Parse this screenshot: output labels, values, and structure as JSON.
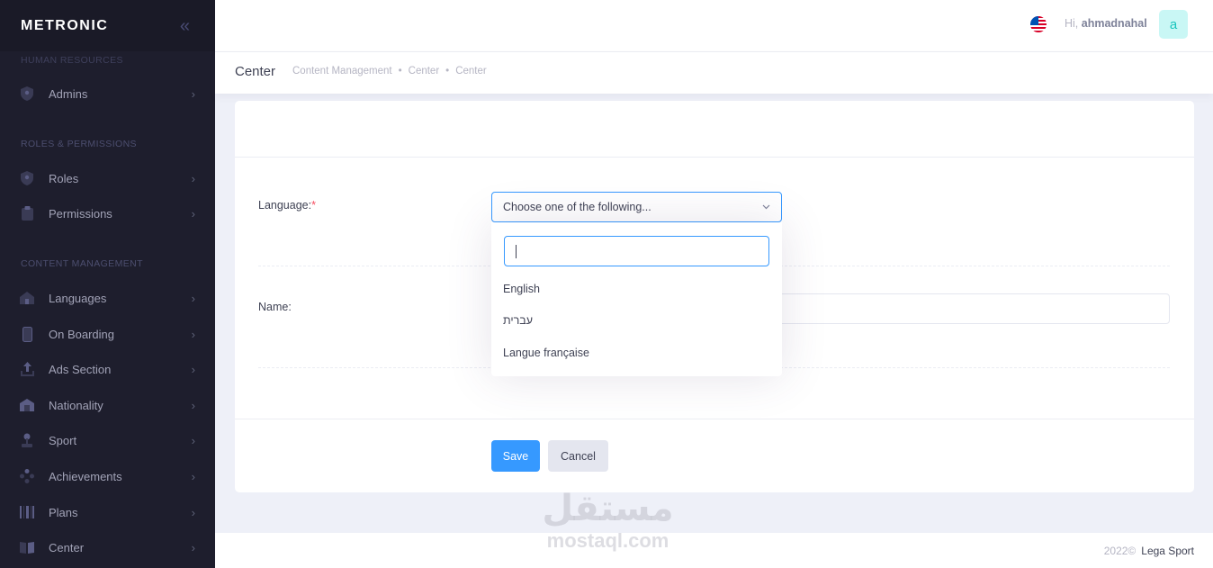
{
  "sidebar": {
    "brand": "METRONIC",
    "sections": {
      "human_resources": "HUMAN RESOURCES",
      "roles_permissions": "ROLES & PERMISSIONS",
      "content_management": "CONTENT MANAGEMENT"
    },
    "items": [
      {
        "label": "Admins",
        "icon": "shield-icon"
      },
      {
        "label": "Roles",
        "icon": "shield-icon"
      },
      {
        "label": "Permissions",
        "icon": "clipboard-icon"
      },
      {
        "label": "Languages",
        "icon": "home-icon"
      },
      {
        "label": "On Boarding",
        "icon": "phone-icon"
      },
      {
        "label": "Ads Section",
        "icon": "upload-icon"
      },
      {
        "label": "Nationality",
        "icon": "building-icon"
      },
      {
        "label": "Sport",
        "icon": "joystick-icon"
      },
      {
        "label": "Achievements",
        "icon": "gamepad-icon"
      },
      {
        "label": "Plans",
        "icon": "barcode-icon"
      },
      {
        "label": "Center",
        "icon": "book-icon"
      }
    ]
  },
  "header": {
    "greeting_prefix": "Hi,",
    "username": "ahmadnahal",
    "avatar_letter": "a",
    "flag": "us-flag-icon"
  },
  "subheader": {
    "title": "Center",
    "breadcrumb": [
      "Content Management",
      "Center",
      "Center"
    ]
  },
  "form": {
    "language_label": "Language:",
    "required_mark": "*",
    "select_placeholder": "Choose one of the following...",
    "search_value": "",
    "options": [
      "English",
      "עברית",
      "Langue française"
    ],
    "name_label": "Name:",
    "name_value": "",
    "save_label": "Save",
    "cancel_label": "Cancel"
  },
  "footer": {
    "year": "2022©",
    "company": "Lega Sport"
  },
  "watermark": {
    "arabic": "مستقل",
    "latin": "mostaql.com"
  },
  "colors": {
    "primary": "#3699ff",
    "sidebar_bg": "#1e1e2d",
    "brand_bg": "#1a1a27",
    "page_bg": "#eef0f8",
    "danger": "#f64e60"
  }
}
